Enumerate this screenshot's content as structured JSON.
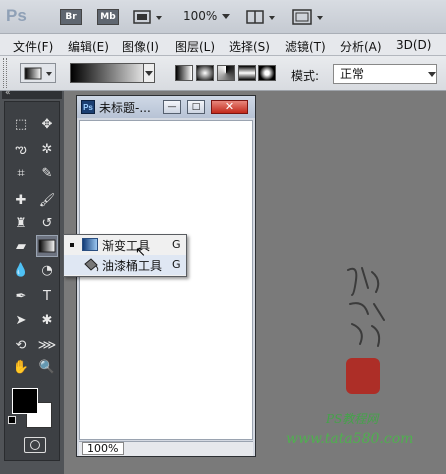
{
  "appbar": {
    "logo": "Ps",
    "bridge": "Br",
    "minibridge": "Mb",
    "zoom": "100%"
  },
  "menubar": {
    "items": [
      "文件(F)",
      "编辑(E)",
      "图像(I)",
      "图层(L)",
      "选择(S)",
      "滤镜(T)",
      "分析(A)",
      "3D(D)"
    ]
  },
  "options": {
    "mode_label": "模式:",
    "mode_value": "正常"
  },
  "document": {
    "ps_badge": "Ps",
    "title": "未标题-...",
    "zoom": "100%",
    "minimize": "—",
    "maximize": "□",
    "close": "✕"
  },
  "flyout": {
    "items": [
      {
        "label": "渐变工具",
        "shortcut": "G",
        "active": true
      },
      {
        "label": "油漆桶工具",
        "shortcut": "G",
        "active": false
      }
    ]
  },
  "watermark": {
    "site": "PS教程网",
    "url": "www.tata580.com"
  },
  "colors": {
    "foreground": "#000000",
    "background": "#ffffff",
    "workspace": "#7a7a7a"
  }
}
